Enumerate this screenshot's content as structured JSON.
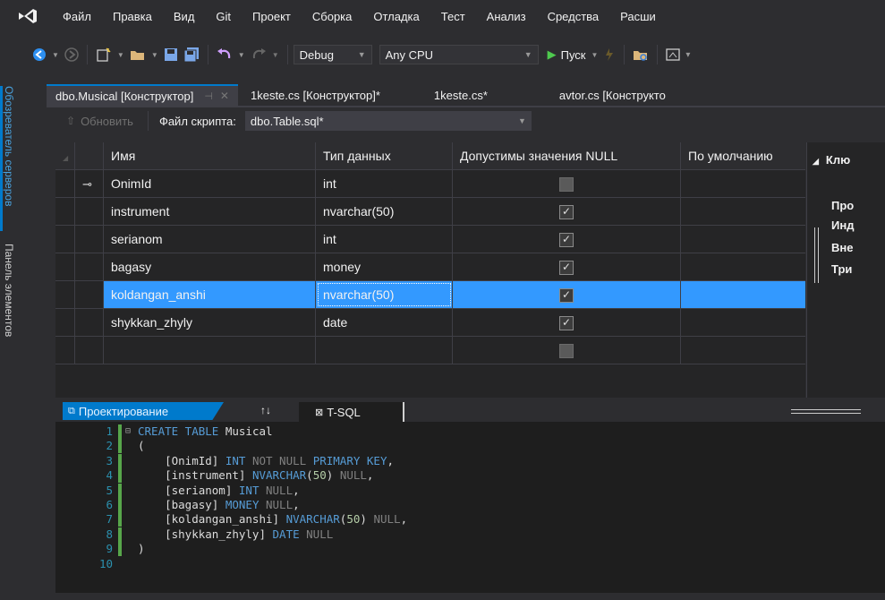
{
  "menu": [
    "Файл",
    "Правка",
    "Вид",
    "Git",
    "Проект",
    "Сборка",
    "Отладка",
    "Тест",
    "Анализ",
    "Средства",
    "Расши"
  ],
  "toolbar": {
    "config": "Debug",
    "platform": "Any CPU",
    "run_label": "Пуск"
  },
  "side_tabs": {
    "server_explorer": "Обозреватель серверов",
    "toolbox": "Панель элементов"
  },
  "tabs": [
    {
      "label": "dbo.Musical [Конструктор]",
      "active": true
    },
    {
      "label": "1keste.cs [Конструктор]*",
      "active": false
    },
    {
      "label": "1keste.cs*",
      "active": false
    },
    {
      "label": "avtor.cs [Конструкто",
      "active": false
    }
  ],
  "designer": {
    "refresh_label": "Обновить",
    "script_file_label": "Файл скрипта:",
    "script_file_value": "dbo.Table.sql*"
  },
  "grid": {
    "headers": [
      "Имя",
      "Тип данных",
      "Допустимы значения NULL",
      "По умолчанию"
    ],
    "rows": [
      {
        "name": "OnimId",
        "type": "int",
        "nullable": false,
        "key": true
      },
      {
        "name": "instrument",
        "type": "nvarchar(50)",
        "nullable": true
      },
      {
        "name": "serianom",
        "type": "int",
        "nullable": true
      },
      {
        "name": "bagasy",
        "type": "money",
        "nullable": true
      },
      {
        "name": "koldangan_anshi",
        "type": "nvarchar(50)",
        "nullable": true,
        "selected": true
      },
      {
        "name": "shykkan_zhyly",
        "type": "date",
        "nullable": true
      },
      {
        "name": "",
        "type": "",
        "nullable": false
      }
    ]
  },
  "props": {
    "keys": "Клю",
    "line1": "Про",
    "line2": "Инд",
    "line3": "Вне",
    "line4": "Три"
  },
  "split": {
    "design_tab": "Проектирование",
    "swap_icon": "↑↓",
    "tsql_tab": "T-SQL"
  },
  "sql": [
    {
      "n": "1",
      "parts": [
        [
          "kw",
          "CREATE TABLE "
        ],
        [
          "id",
          "Musical"
        ]
      ]
    },
    {
      "n": "2",
      "parts": [
        [
          "id",
          "("
        ]
      ]
    },
    {
      "n": "3",
      "parts": [
        [
          "id",
          "    [OnimId] "
        ],
        [
          "ty",
          "INT "
        ],
        [
          "gr",
          "NOT NULL "
        ],
        [
          "kw",
          "PRIMARY KEY"
        ],
        [
          "id",
          ","
        ]
      ]
    },
    {
      "n": "4",
      "parts": [
        [
          "id",
          "    [instrument] "
        ],
        [
          "ty",
          "NVARCHAR"
        ],
        [
          "id",
          "("
        ],
        [
          "num",
          "50"
        ],
        [
          "id",
          ") "
        ],
        [
          "gr",
          "NULL"
        ],
        [
          "id",
          ","
        ]
      ]
    },
    {
      "n": "5",
      "parts": [
        [
          "id",
          "    [serianom] "
        ],
        [
          "ty",
          "INT "
        ],
        [
          "gr",
          "NULL"
        ],
        [
          "id",
          ","
        ]
      ]
    },
    {
      "n": "6",
      "parts": [
        [
          "id",
          "    [bagasy] "
        ],
        [
          "ty",
          "MONEY "
        ],
        [
          "gr",
          "NULL"
        ],
        [
          "id",
          ","
        ]
      ]
    },
    {
      "n": "7",
      "parts": [
        [
          "id",
          "    [koldangan_anshi] "
        ],
        [
          "ty",
          "NVARCHAR"
        ],
        [
          "id",
          "("
        ],
        [
          "num",
          "50"
        ],
        [
          "id",
          ") "
        ],
        [
          "gr",
          "NULL"
        ],
        [
          "id",
          ","
        ]
      ]
    },
    {
      "n": "8",
      "parts": [
        [
          "id",
          "    [shykkan_zhyly] "
        ],
        [
          "ty",
          "DATE "
        ],
        [
          "gr",
          "NULL"
        ]
      ]
    },
    {
      "n": "9",
      "parts": [
        [
          "id",
          ")"
        ]
      ]
    },
    {
      "n": "10",
      "parts": []
    }
  ],
  "colors": {
    "accent": "#007acc",
    "selection": "#3399ff",
    "background": "#2d2d30",
    "editor": "#1e1e1e"
  }
}
